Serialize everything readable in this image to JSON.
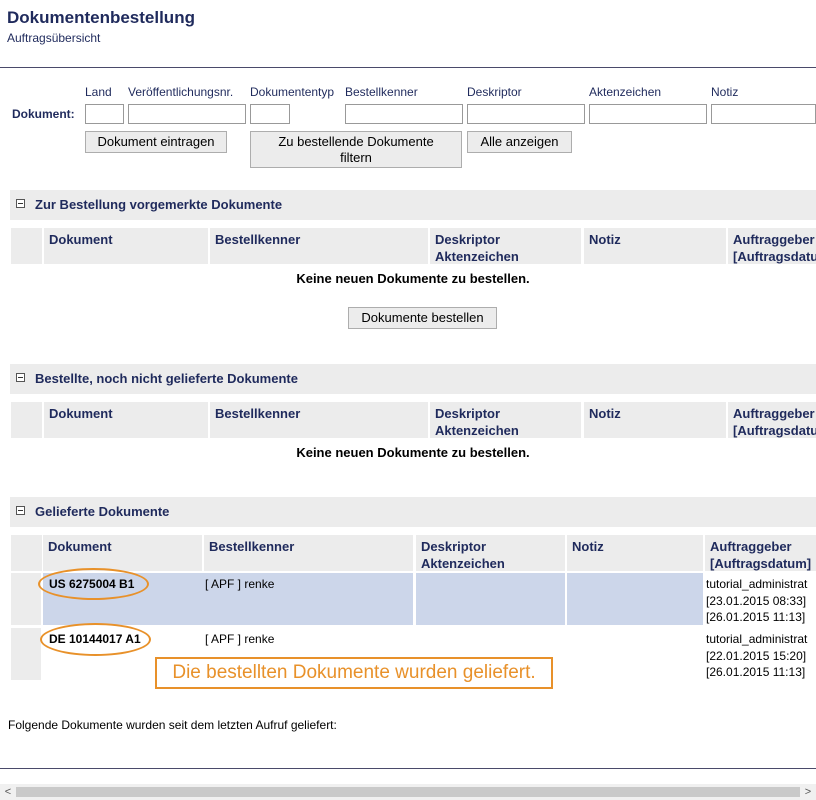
{
  "header": {
    "title": "Dokumentenbestellung",
    "subtitle": "Auftragsübersicht"
  },
  "filter": {
    "row_label": "Dokument:",
    "fields": [
      "Land",
      "Veröffentlichungsnr.",
      "Dokumententyp",
      "Bestellkenner",
      "Deskriptor",
      "Aktenzeichen",
      "Notiz"
    ],
    "btn_enter": "Dokument eintragen",
    "btn_filter_1": "Zu bestellende Dokumente",
    "btn_filter_2": "filtern",
    "btn_all": "Alle anzeigen"
  },
  "columns": {
    "dokument": "Dokument",
    "bestellkenner": "Bestellkenner",
    "deskriptor": "Deskriptor",
    "aktenzeichen": "Aktenzeichen",
    "notiz": "Notiz",
    "auftraggeber": "Auftraggeber",
    "auftragsdatum": "[Auftragsdatum]"
  },
  "sections": {
    "vorgemerkt": {
      "title": "Zur Bestellung vorgemerkte Dokumente",
      "empty": "Keine neuen Dokumente zu bestellen.",
      "order_button": "Dokumente bestellen"
    },
    "bestellt": {
      "title": "Bestellte, noch nicht gelieferte Dokumente",
      "empty": "Keine neuen Dokumente zu bestellen."
    },
    "geliefert": {
      "title": "Gelieferte Dokumente",
      "rows": [
        {
          "doc": "US 6275004 B1",
          "bestellkenner": "[ APF ] renke",
          "user": "tutorial_administrat",
          "date1": "[23.01.2015 08:33]",
          "date2": "[26.01.2015 11:13]"
        },
        {
          "doc": "DE 10144017 A1",
          "bestellkenner": "[ APF ] renke",
          "user": "tutorial_administrat",
          "date1": "[22.01.2015 15:20]",
          "date2": "[26.01.2015 11:13]"
        }
      ]
    }
  },
  "annotation": "Die bestellten Dokumente wurden geliefert.",
  "footer": "Folgende Dokumente wurden seit dem letzten Aufruf geliefert:",
  "colors": {
    "accent": "#1f2a5c",
    "highlight": "#ccd6ea",
    "annotation": "#e8912a"
  }
}
